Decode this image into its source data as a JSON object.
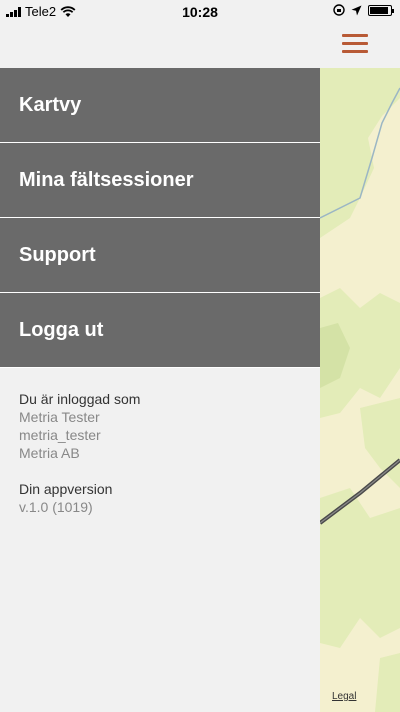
{
  "status_bar": {
    "carrier": "Tele2",
    "time": "10:28"
  },
  "menu": {
    "items": [
      {
        "label": "Kartvy"
      },
      {
        "label": "Mina fältsessioner"
      },
      {
        "label": "Support"
      },
      {
        "label": "Logga ut"
      }
    ]
  },
  "user_info": {
    "logged_in_label": "Du är inloggad som",
    "name": "Metria Tester",
    "username": "metria_tester",
    "organization": "Metria AB"
  },
  "app_version": {
    "label": "Din appversion",
    "value": "v.1.0 (1019)"
  },
  "map": {
    "legal_label": "Legal"
  },
  "colors": {
    "accent": "#b85a36",
    "menu_bg": "#6a6a6a",
    "panel_bg": "#f1f1f1",
    "map_light": "#f4f0cf",
    "map_green": "#e3ecb8"
  },
  "battery": {
    "level": 0.9
  }
}
